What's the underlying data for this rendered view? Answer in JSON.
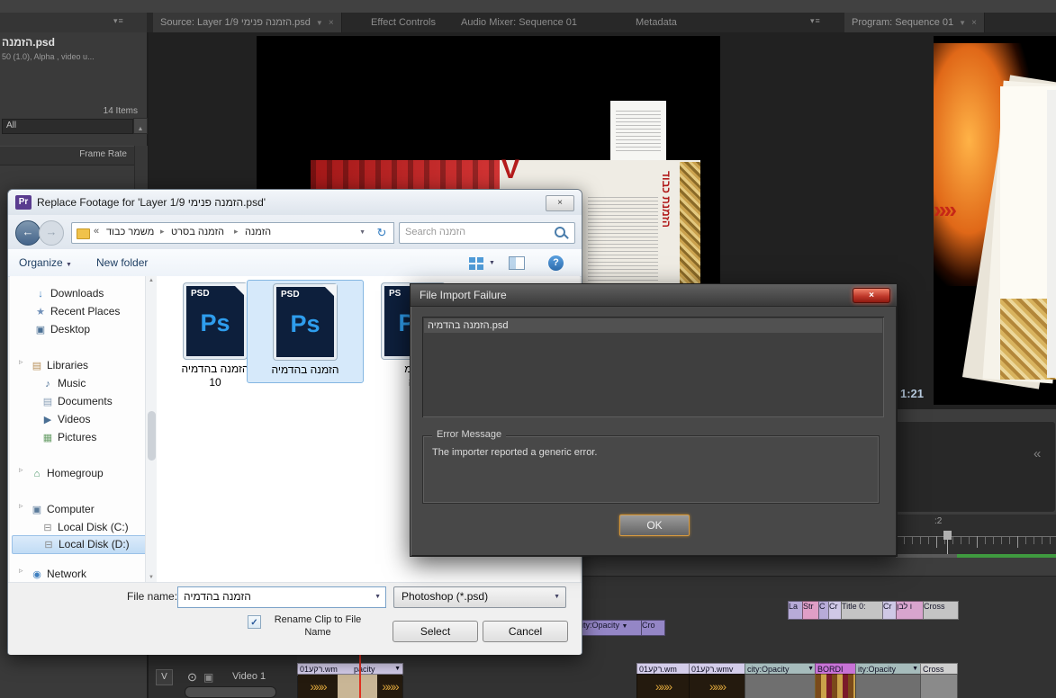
{
  "glyphs": {
    "caret_down": "▼",
    "caret_up": "▲",
    "panel_menu": "▾≡",
    "close": "×",
    "back": "←",
    "forward": "→",
    "refresh": "↻",
    "guillemet": "«",
    "crumb_sep": "▸",
    "expander": "▹",
    "help": "?",
    "check": "✓",
    "gold_arrows": "»»»",
    "red_chevrons": "»»",
    "eye": "⊙",
    "track_box": "▣",
    "collapse": "«"
  },
  "premiere": {
    "tabs": {
      "source": "Source: Layer 1/9 הזמנה פנימי.psd",
      "effect_controls": "Effect Controls",
      "audio_mixer": "Audio Mixer: Sequence 01",
      "metadata": "Metadata",
      "program": "Program: Sequence 01"
    },
    "project": {
      "clip_name": "הזמנה.psd",
      "clip_info": "50 (1.0), Alpha , video u...",
      "items": "14 Items",
      "filter": "All",
      "column": "Frame Rate"
    },
    "program_monitor": {
      "timecode": "1:21",
      "ruler_label": ":2"
    }
  },
  "source_preview": {
    "vertical_title": "הזמנת כבוד"
  },
  "explorer": {
    "title": "Replace Footage for 'Layer 1/9 הזמנה פנימי.psd'",
    "breadcrumb": {
      "items": [
        "משמר כבוד",
        "הזמנה בסרט",
        "הזמנה"
      ]
    },
    "search_placeholder": "Search הזמנה",
    "organize": "Organize",
    "new_folder": "New folder",
    "sidebar": {
      "items": [
        {
          "label": "Downloads",
          "glyph": "↓",
          "color": "#3f7fbf"
        },
        {
          "label": "Recent Places",
          "glyph": "★",
          "color": "#6f8fb8"
        },
        {
          "label": "Desktop",
          "glyph": "▣",
          "color": "#4a6f94"
        },
        {
          "label": "Libraries",
          "glyph": "▤",
          "color": "#b8905a"
        },
        {
          "label": "Music",
          "glyph": "♪",
          "color": "#4a6f94"
        },
        {
          "label": "Documents",
          "glyph": "▤",
          "color": "#8aa0b8"
        },
        {
          "label": "Videos",
          "glyph": "▶",
          "color": "#4a6f94"
        },
        {
          "label": "Pictures",
          "glyph": "▦",
          "color": "#6a9f6a"
        },
        {
          "label": "Homegroup",
          "glyph": "⌂",
          "color": "#3f8f5f"
        },
        {
          "label": "Computer",
          "glyph": "▣",
          "color": "#5a7a9a"
        },
        {
          "label": "Local Disk (C:)",
          "glyph": "⊟",
          "color": "#8a8a8a"
        },
        {
          "label": "Local Disk (D:)",
          "glyph": "⊟",
          "color": "#8a8a8a"
        },
        {
          "label": "Network",
          "glyph": "◉",
          "color": "#3f7fbf"
        }
      ]
    },
    "files": [
      {
        "badge": "PSD",
        "app": "Ps",
        "line1": "הזמנה בהדמיה",
        "line2": "10"
      },
      {
        "badge": "PSD",
        "app": "Ps",
        "line1": "הזמנה בהדמיה",
        "line2": ""
      },
      {
        "badge": "PS",
        "app": "Ps",
        "line1": "הזמ",
        "line2": "יה"
      }
    ],
    "file_name_label": "File name:",
    "file_name_value": "הזמנה בהדמיה",
    "file_type_value": "Photoshop (*.psd)",
    "rename_label": "Rename Clip to File Name",
    "select": "Select",
    "cancel": "Cancel"
  },
  "error_dialog": {
    "title": "File Import Failure",
    "file": "הזמנה בהדמיה.psd",
    "group": "Error Message",
    "message": "The importer reported a generic error.",
    "ok": "OK"
  },
  "timeline": {
    "track": {
      "v": "V",
      "name": "Video 1"
    },
    "fx_clips": [
      {
        "label": "ity:Opacity"
      },
      {
        "label": "Cro"
      }
    ],
    "small_clips": [
      {
        "label": "La"
      },
      {
        "label": "Str"
      },
      {
        "label": "C"
      },
      {
        "label": "Cr"
      },
      {
        "label": "Title 0:"
      },
      {
        "label": "Cr"
      },
      {
        "label": "ו לבן"
      },
      {
        "label": "Cross"
      }
    ],
    "clips": [
      {
        "name": "01רקע.wm",
        "fx": "pacity"
      },
      {
        "name": "01רקע.wm",
        "fx": ""
      },
      {
        "name": "01רקע.wmv",
        "fx": ""
      },
      {
        "name": "city:Opacity",
        "fx": ""
      },
      {
        "name": "BORDI",
        "fx": ""
      },
      {
        "name": "ity:Opacity",
        "fx": ""
      },
      {
        "name": "Cross",
        "fx": ""
      }
    ]
  }
}
